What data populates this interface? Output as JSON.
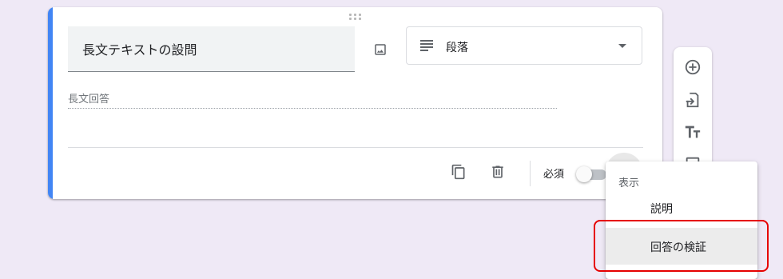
{
  "question": {
    "title": "長文テキストの設問",
    "type_label": "段落",
    "answer_placeholder": "長文回答"
  },
  "footer": {
    "required_label": "必須",
    "required_on": false
  },
  "toolbar": {
    "icons": [
      "add-question-icon",
      "import-questions-icon",
      "add-title-icon",
      "add-image-icon"
    ]
  },
  "menu": {
    "header": "表示",
    "items": [
      {
        "label": "説明",
        "selected": false
      },
      {
        "label": "回答の検証",
        "selected": true
      }
    ]
  },
  "colors": {
    "accent": "#4285f4",
    "background": "#efe9f6",
    "highlight": "#e60000"
  }
}
